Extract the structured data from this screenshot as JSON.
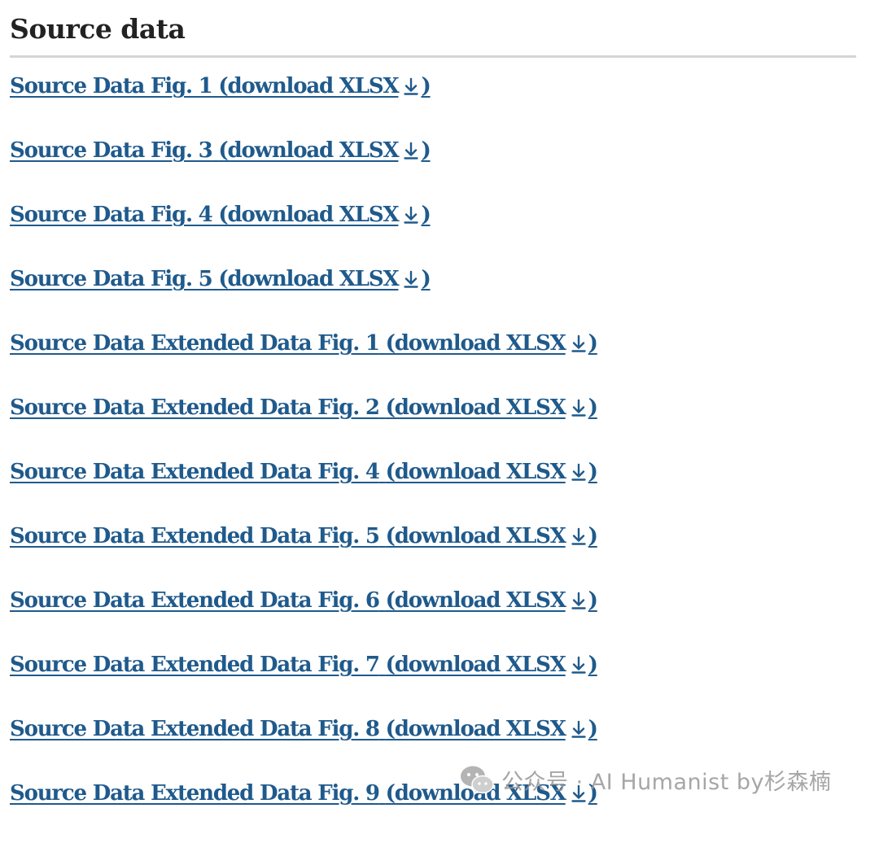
{
  "section": {
    "title": "Source data"
  },
  "links": [
    {
      "label": "Source Data Fig. 1",
      "suffix_open": "(download XLSX",
      "suffix_close": ")"
    },
    {
      "label": "Source Data Fig. 3",
      "suffix_open": "(download XLSX",
      "suffix_close": ")"
    },
    {
      "label": "Source Data Fig. 4",
      "suffix_open": "(download XLSX",
      "suffix_close": ")"
    },
    {
      "label": "Source Data Fig. 5",
      "suffix_open": "(download XLSX",
      "suffix_close": ")"
    },
    {
      "label": "Source Data Extended Data Fig. 1",
      "suffix_open": "(download XLSX",
      "suffix_close": ")"
    },
    {
      "label": "Source Data Extended Data Fig. 2",
      "suffix_open": "(download XLSX",
      "suffix_close": ")"
    },
    {
      "label": "Source Data Extended Data Fig. 4",
      "suffix_open": "(download XLSX",
      "suffix_close": ")"
    },
    {
      "label": "Source Data Extended Data Fig. 5",
      "suffix_open": "(download XLSX",
      "suffix_close": ")"
    },
    {
      "label": "Source Data Extended Data Fig. 6",
      "suffix_open": "(download XLSX",
      "suffix_close": ")"
    },
    {
      "label": "Source Data Extended Data Fig. 7",
      "suffix_open": "(download XLSX",
      "suffix_close": ")"
    },
    {
      "label": "Source Data Extended Data Fig. 8",
      "suffix_open": "(download XLSX",
      "suffix_close": ")"
    },
    {
      "label": "Source Data Extended Data Fig. 9",
      "suffix_open": "(download XLSX",
      "suffix_close": ")"
    }
  ],
  "icons": {
    "download": "download-arrow-icon",
    "watermark_logo": "wechat-icon"
  },
  "watermark": {
    "text": "公众号 · AI Humanist by杉森楠"
  },
  "colors": {
    "link": "#1f5a8c",
    "title": "#222222",
    "divider": "#d5d5d5",
    "watermark": "#969696"
  }
}
